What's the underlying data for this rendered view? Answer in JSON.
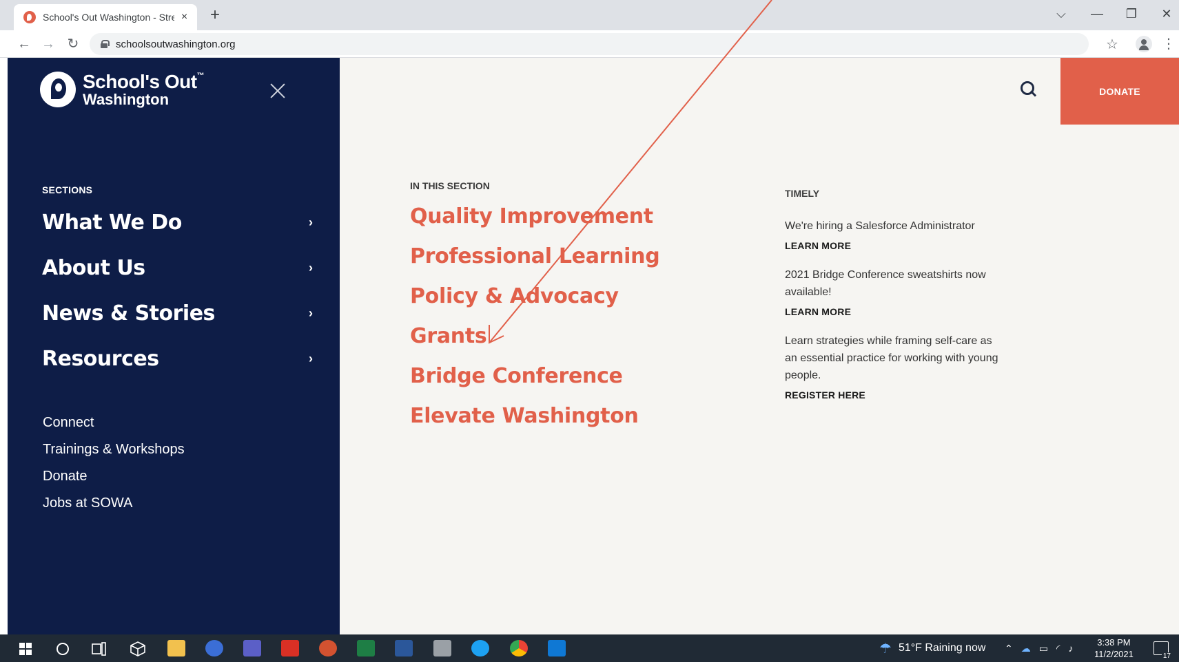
{
  "browser": {
    "tab_title": "School's Out Washington - Stren",
    "tab_close": "×",
    "new_tab": "+",
    "url": "schoolsoutwashington.org",
    "win_chevron": "⌵",
    "win_minimize": "—",
    "win_restore": "❐",
    "win_close": "✕",
    "back": "←",
    "forward": "→",
    "reload": "↻",
    "star": "☆",
    "menu": "⋮"
  },
  "logo": {
    "line1": "School's Out",
    "tm": "™",
    "line2": "Washington"
  },
  "sidebar": {
    "sections_label": "SECTIONS",
    "main_items": [
      {
        "label": "What We Do"
      },
      {
        "label": "About Us"
      },
      {
        "label": "News & Stories"
      },
      {
        "label": "Resources"
      }
    ],
    "chevron": "›",
    "secondary_items": [
      {
        "label": "Connect"
      },
      {
        "label": "Trainings & Workshops"
      },
      {
        "label": "Donate"
      },
      {
        "label": "Jobs at SOWA"
      }
    ]
  },
  "header": {
    "donate_label": "DONATE"
  },
  "in_this_section": {
    "label": "IN THIS SECTION",
    "links": [
      {
        "label": "Quality Improvement"
      },
      {
        "label": "Professional Learning"
      },
      {
        "label": "Policy & Advocacy"
      },
      {
        "label": "Grants"
      },
      {
        "label": "Bridge Conference"
      },
      {
        "label": "Elevate Washington"
      }
    ]
  },
  "timely": {
    "label": "TIMELY",
    "items": [
      {
        "text": "We're hiring a Salesforce Administrator",
        "cta": "LEARN MORE"
      },
      {
        "text": "2021 Bridge Conference sweatshirts now available!",
        "cta": "LEARN MORE"
      },
      {
        "text": "Learn strategies while framing self-care as an essential practice for working with young people.",
        "cta": "REGISTER HERE"
      }
    ]
  },
  "taskbar": {
    "weather": "51°F  Raining now",
    "time": "3:38 PM",
    "date": "11/2/2021",
    "notifications": "17"
  },
  "colors": {
    "navy": "#0e1d47",
    "coral": "#e1604a",
    "page_bg": "#f6f5f2"
  }
}
